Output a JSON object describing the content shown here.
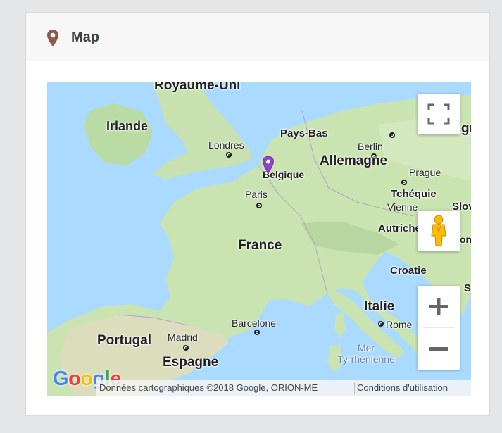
{
  "panel": {
    "title": "Map",
    "icon": "map-marker-icon",
    "icon_color": "#8e5a4d"
  },
  "map": {
    "labels": {
      "royaume_uni": "Royaume-Uni",
      "irlande": "Irlande",
      "londres": "Londres",
      "pays_bas": "Pays-Bas",
      "berlin": "Berlin",
      "allemagne": "Allemagne",
      "belgique": "Belgique",
      "prague": "Prague",
      "paris": "Paris",
      "tchequie": "Tchéquie",
      "vienne": "Vienne",
      "slov": "Slov",
      "gr": "gr",
      "autriche": "Autriche",
      "france": "France",
      "croatie": "Croatie",
      "italie": "Italie",
      "barcelone": "Barcelone",
      "rome": "Rome",
      "portugal": "Portugal",
      "madrid": "Madrid",
      "espagne": "Espagne",
      "mer": "Mer",
      "tyrrhenienne": "Tyrrhénienne",
      "s": "S",
      "one": "one"
    },
    "marker_color": "#8e44c8",
    "attribution": "Données cartographiques ©2018 Google, ORION-ME",
    "terms": "Conditions d'utilisation",
    "google_letters": [
      "G",
      "o",
      "o",
      "g",
      "l",
      "e"
    ],
    "google_colors": [
      "#4285f4",
      "#ea4335",
      "#fbbc05",
      "#4285f4",
      "#34a853",
      "#ea4335"
    ]
  },
  "controls": {
    "fullscreen_icon": "fullscreen-icon",
    "pegman_icon": "pegman-icon",
    "zoom_in_icon": "plus-icon",
    "zoom_out_icon": "minus-icon"
  }
}
